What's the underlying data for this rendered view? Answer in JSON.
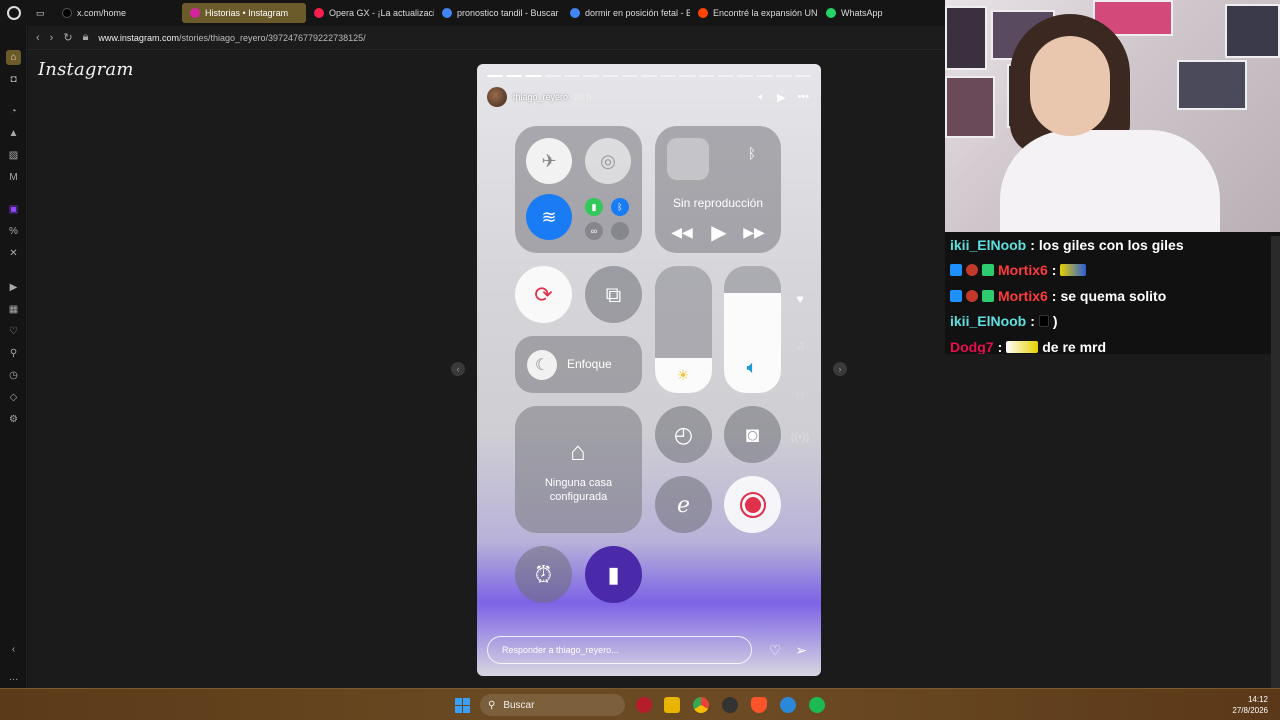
{
  "browser": {
    "tabs": [
      {
        "label": "x.com/home",
        "active": false,
        "color": "#000000"
      },
      {
        "label": "Historias • Instagram",
        "active": true,
        "color": "#d6249f"
      },
      {
        "label": "Opera GX - ¡La actualizació",
        "active": false,
        "color": "#fa1e4e"
      },
      {
        "label": "pronostico tandil - Buscar",
        "active": false,
        "color": "#4285f4"
      },
      {
        "label": "dormir en posición fetal - B",
        "active": false,
        "color": "#4285f4"
      },
      {
        "label": "Encontré la expansión UNC",
        "active": false,
        "color": "#ff4500"
      },
      {
        "label": "WhatsApp",
        "active": false,
        "color": "#25d366"
      }
    ],
    "url_host": "www.instagram.com",
    "url_path": "/stories/thiago_reyero/3972476779222738125/"
  },
  "instagram": {
    "logo": "Instagram",
    "story": {
      "username": "thiago_reyero",
      "time": "20 h",
      "reply_placeholder": "Responder a thiago_reyero...",
      "progress_total": 17,
      "progress_done": 3,
      "control_center": {
        "now_playing": "Sin reproducción",
        "focus_label": "Enfoque",
        "home_label": "Ninguna casa configurada"
      }
    }
  },
  "chat": {
    "messages": [
      {
        "user": "ikii_ElNoob",
        "color": "#5fe0e0",
        "text": "los giles con los giles"
      },
      {
        "user": "Mortix6",
        "color": "#ff3b3b",
        "text": ""
      },
      {
        "user": "Mortix6",
        "color": "#ff3b3b",
        "text": "se quema solito"
      },
      {
        "user": "ikii_ElNoob",
        "color": "#5fe0e0",
        "text": ")"
      },
      {
        "user": "Dodg7",
        "color": "#e8104a",
        "text": "de re mrd"
      }
    ]
  },
  "taskbar": {
    "search_label": "Buscar",
    "time": "14:12",
    "date": "27/8/2026"
  }
}
